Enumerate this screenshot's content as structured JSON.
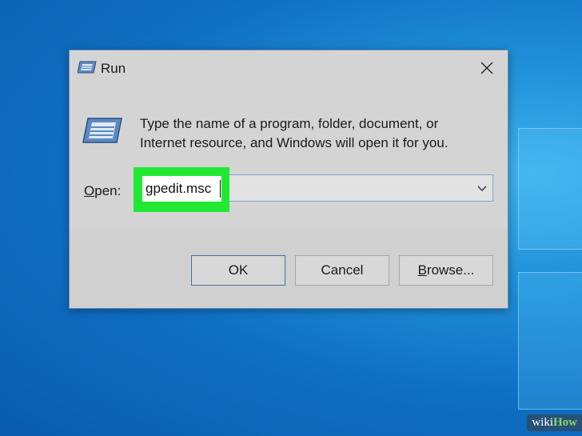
{
  "dialog": {
    "title": "Run",
    "description_line1": "Type the name of a program, folder, document, or",
    "description_line2": "Internet resource, and Windows will open it for you.",
    "open_label_accel": "O",
    "open_label_rest": "pen:",
    "open_value": "gpedit.msc",
    "icons": {
      "title": "run-app-icon",
      "big": "run-app-icon",
      "close": "close-icon",
      "dropdown": "chevron-down-icon"
    },
    "buttons": {
      "ok": "OK",
      "cancel": "Cancel",
      "browse_accel": "B",
      "browse_rest": "rowse..."
    }
  },
  "watermark": {
    "part1": "wiki",
    "part2": "How"
  },
  "colors": {
    "highlight": "#22e833",
    "dialog_bg": "#d4d4d4",
    "desktop": "#0f6fc2"
  }
}
